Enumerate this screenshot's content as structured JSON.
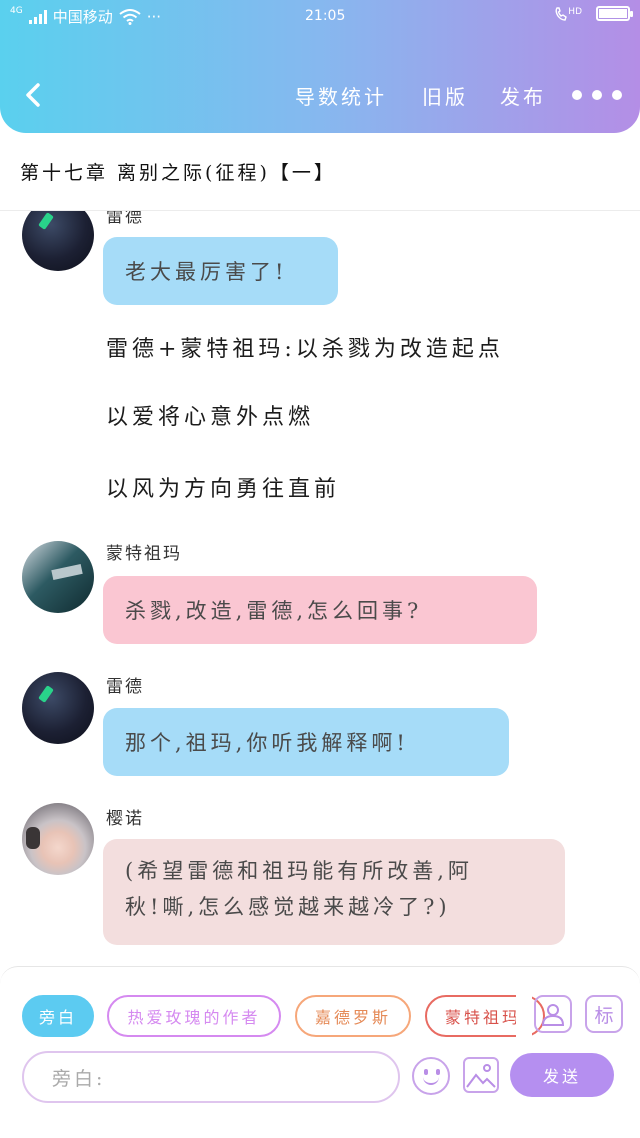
{
  "status_bar": {
    "network": "4G",
    "carrier": "中国移动",
    "extra": "···",
    "time": "21:05",
    "call_badge": "HD"
  },
  "nav": {
    "items": [
      "导数统计",
      "旧版",
      "发布"
    ]
  },
  "chapter": {
    "title": "第十七章 离别之际(征程)【一】"
  },
  "feed": {
    "partial_name": "雷德",
    "messages": [
      {
        "speaker": "",
        "text": "老大最厉害了!"
      },
      {
        "speaker": "蒙特祖玛",
        "text": "杀戮,改造,雷德,怎么回事?"
      },
      {
        "speaker": "雷德",
        "text": "那个,祖玛,你听我解释啊!"
      },
      {
        "speaker": "樱诺",
        "text_lines": [
          "(希望雷德和祖玛能有所改善,阿",
          "秋!嘶,怎么感觉越来越冷了?)"
        ]
      }
    ],
    "narration": [
      "雷德+蒙特祖玛:以杀戮为改造起点",
      "以爱将心意外点燃",
      "以风为方向勇往直前"
    ]
  },
  "composer": {
    "chips": [
      "旁白",
      "热爱玫瑰的作者",
      "嘉德罗斯",
      "蒙特祖玛"
    ],
    "tag_label": "标",
    "input_placeholder": "旁白:",
    "send_label": "发送"
  }
}
